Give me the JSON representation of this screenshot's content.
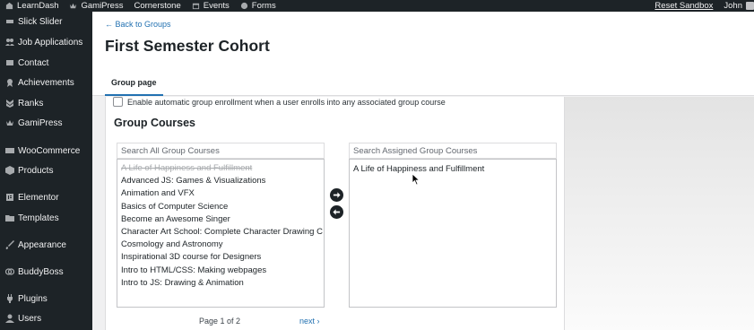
{
  "admin_bar": {
    "items": [
      {
        "label": "LearnDash",
        "icon": "learndash-icon"
      },
      {
        "label": "GamiPress",
        "icon": "crown-icon"
      },
      {
        "label": "Cornerstone",
        "icon": ""
      },
      {
        "label": "Events",
        "icon": "calendar-icon"
      },
      {
        "label": "Forms",
        "icon": "forms-icon"
      }
    ],
    "reset_label": "Reset Sandbox",
    "user_label": "John"
  },
  "sidebar": {
    "items": [
      {
        "label": "Slick Slider",
        "icon": "slider-icon"
      },
      {
        "label": "Job Applications",
        "icon": "people-icon"
      },
      {
        "label": "Contact",
        "icon": "mail-icon"
      },
      {
        "label": "Achievements",
        "icon": "ribbon-icon"
      },
      {
        "label": "Ranks",
        "icon": "ranks-icon"
      },
      {
        "label": "GamiPress",
        "icon": "crown-icon"
      },
      {
        "label": "WooCommerce",
        "icon": "woo-icon"
      },
      {
        "label": "Products",
        "icon": "box-icon"
      },
      {
        "label": "Elementor",
        "icon": "elementor-icon"
      },
      {
        "label": "Templates",
        "icon": "folder-icon"
      },
      {
        "label": "Appearance",
        "icon": "brush-icon"
      },
      {
        "label": "BuddyBoss",
        "icon": "buddyboss-icon"
      },
      {
        "label": "Plugins",
        "icon": "plug-icon"
      },
      {
        "label": "Users",
        "icon": "user-icon"
      }
    ]
  },
  "header": {
    "back_link": "← Back to Groups",
    "title": "First Semester Cohort",
    "tab_label": "Group page"
  },
  "panel": {
    "enroll_label": "Enable automatic group enrollment when a user enrolls into any associated group course",
    "section_title": "Group Courses",
    "all_search_placeholder": "Search All Group Courses",
    "assigned_search_placeholder": "Search Assigned Group Courses",
    "all_courses": [
      {
        "label": "A Life of Happiness and Fulfillment",
        "disabled": true
      },
      {
        "label": "Advanced JS: Games & Visualizations",
        "disabled": false
      },
      {
        "label": "Animation and VFX",
        "disabled": false
      },
      {
        "label": "Basics of Computer Science",
        "disabled": false
      },
      {
        "label": "Become an Awesome Singer",
        "disabled": false
      },
      {
        "label": "Character Art School: Complete Character Drawing C",
        "disabled": false
      },
      {
        "label": "Cosmology and Astronomy",
        "disabled": false
      },
      {
        "label": "Inspirational 3D course for Designers",
        "disabled": false
      },
      {
        "label": "Intro to HTML/CSS: Making webpages",
        "disabled": false
      },
      {
        "label": "Intro to JS: Drawing & Animation",
        "disabled": false
      }
    ],
    "assigned_courses": [
      {
        "label": "A Life of Happiness and Fulfillment"
      }
    ],
    "pager_text": "Page 1 of 2",
    "next_label": "next ›"
  },
  "colors": {
    "admin_bar_bg": "#1d2327",
    "link": "#2271b1",
    "tab_underline": "#2271b1"
  }
}
